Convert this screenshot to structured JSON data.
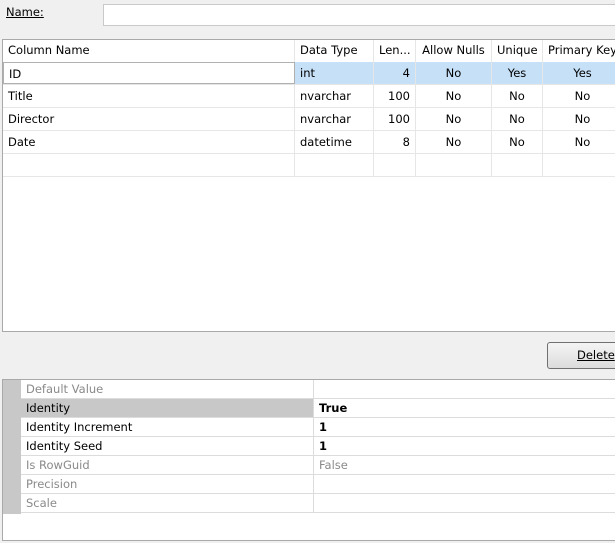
{
  "name_field": {
    "label": "Name:",
    "value": ""
  },
  "columns_grid": {
    "headers": [
      "Column Name",
      "Data Type",
      "Len...",
      "Allow Nulls",
      "Unique",
      "Primary Key"
    ],
    "rows": [
      [
        "ID",
        "int",
        "4",
        "No",
        "Yes",
        "Yes"
      ],
      [
        "Title",
        "nvarchar",
        "100",
        "No",
        "No",
        "No"
      ],
      [
        "Director",
        "nvarchar",
        "100",
        "No",
        "No",
        "No"
      ],
      [
        "Date",
        "datetime",
        "8",
        "No",
        "No",
        "No"
      ]
    ],
    "selected_row": 0,
    "selection_color": "#c6e0f7"
  },
  "delete_button": {
    "label": "Delete"
  },
  "properties": [
    {
      "name": "Default Value",
      "value": "",
      "enabled": false
    },
    {
      "name": "Identity",
      "value": "True",
      "enabled": true,
      "selected": true
    },
    {
      "name": "Identity Increment",
      "value": "1",
      "enabled": true
    },
    {
      "name": "Identity Seed",
      "value": "1",
      "enabled": true
    },
    {
      "name": "Is RowGuid",
      "value": "False",
      "enabled": false
    },
    {
      "name": "Precision",
      "value": "",
      "enabled": false
    },
    {
      "name": "Scale",
      "value": "",
      "enabled": false
    }
  ]
}
